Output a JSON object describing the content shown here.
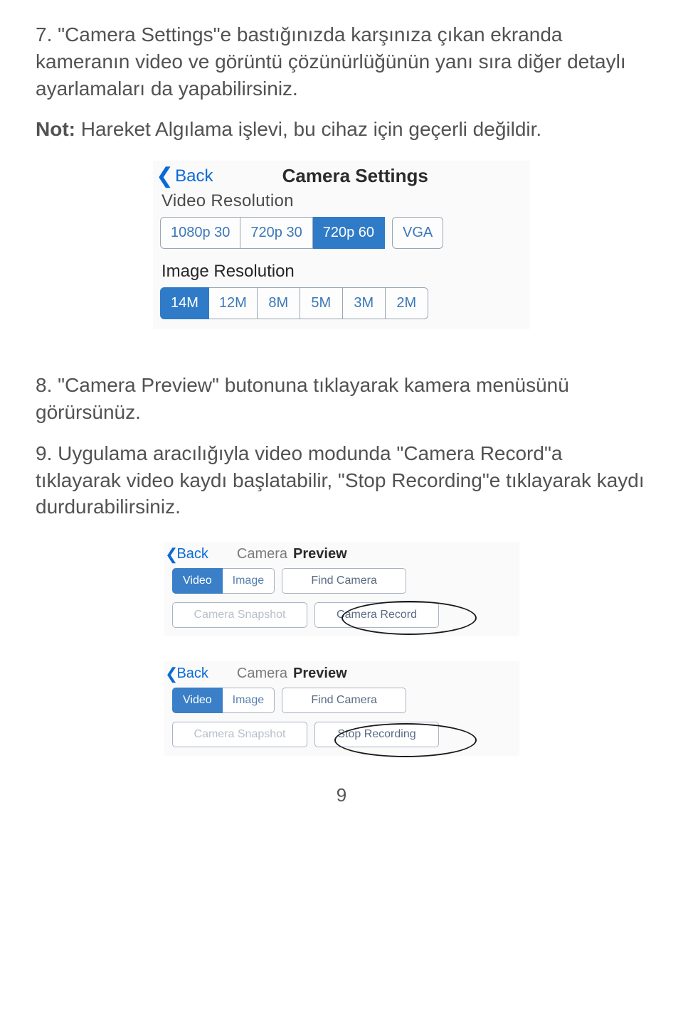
{
  "para7": "7. \"Camera Settings\"e bastığınızda karşınıza çıkan ekranda kameranın video ve görüntü çözünürlüğünün yanı sıra diğer detaylı ayarlamaları da yapabilirsiniz.",
  "note_label": "Not:",
  "note_text": " Hareket Algılama işlevi, bu cihaz için geçerli değildir.",
  "settings": {
    "back": "Back",
    "title": "Camera Settings",
    "video_label": "Video Resolution",
    "video_opts": [
      "1080p 30",
      "720p 30",
      "720p 60",
      "VGA"
    ],
    "video_selected": 2,
    "image_label": "Image Resolution",
    "image_opts": [
      "14M",
      "12M",
      "8M",
      "5M",
      "3M",
      "2M"
    ],
    "image_selected": 0
  },
  "para8": "8. \"Camera Preview\" butonuna tıklayarak kamera menüsünü görürsünüz.",
  "para9": "9. Uygulama aracılığıyla video modunda \"Camera Record\"a tıklayarak video kaydı başlatabilir, \"Stop Recording\"e tıklayarak kaydı durdurabilirsiniz.",
  "preview": {
    "back": "Back",
    "title_light": "Camera",
    "title_bold": "Preview",
    "tabs": [
      "Video",
      "Image"
    ],
    "tab_selected": 0,
    "find": "Find Camera",
    "snapshot": "Camera Snapshot",
    "record": "Camera  Record",
    "stop": "Stop Recording"
  },
  "page_number": "9"
}
